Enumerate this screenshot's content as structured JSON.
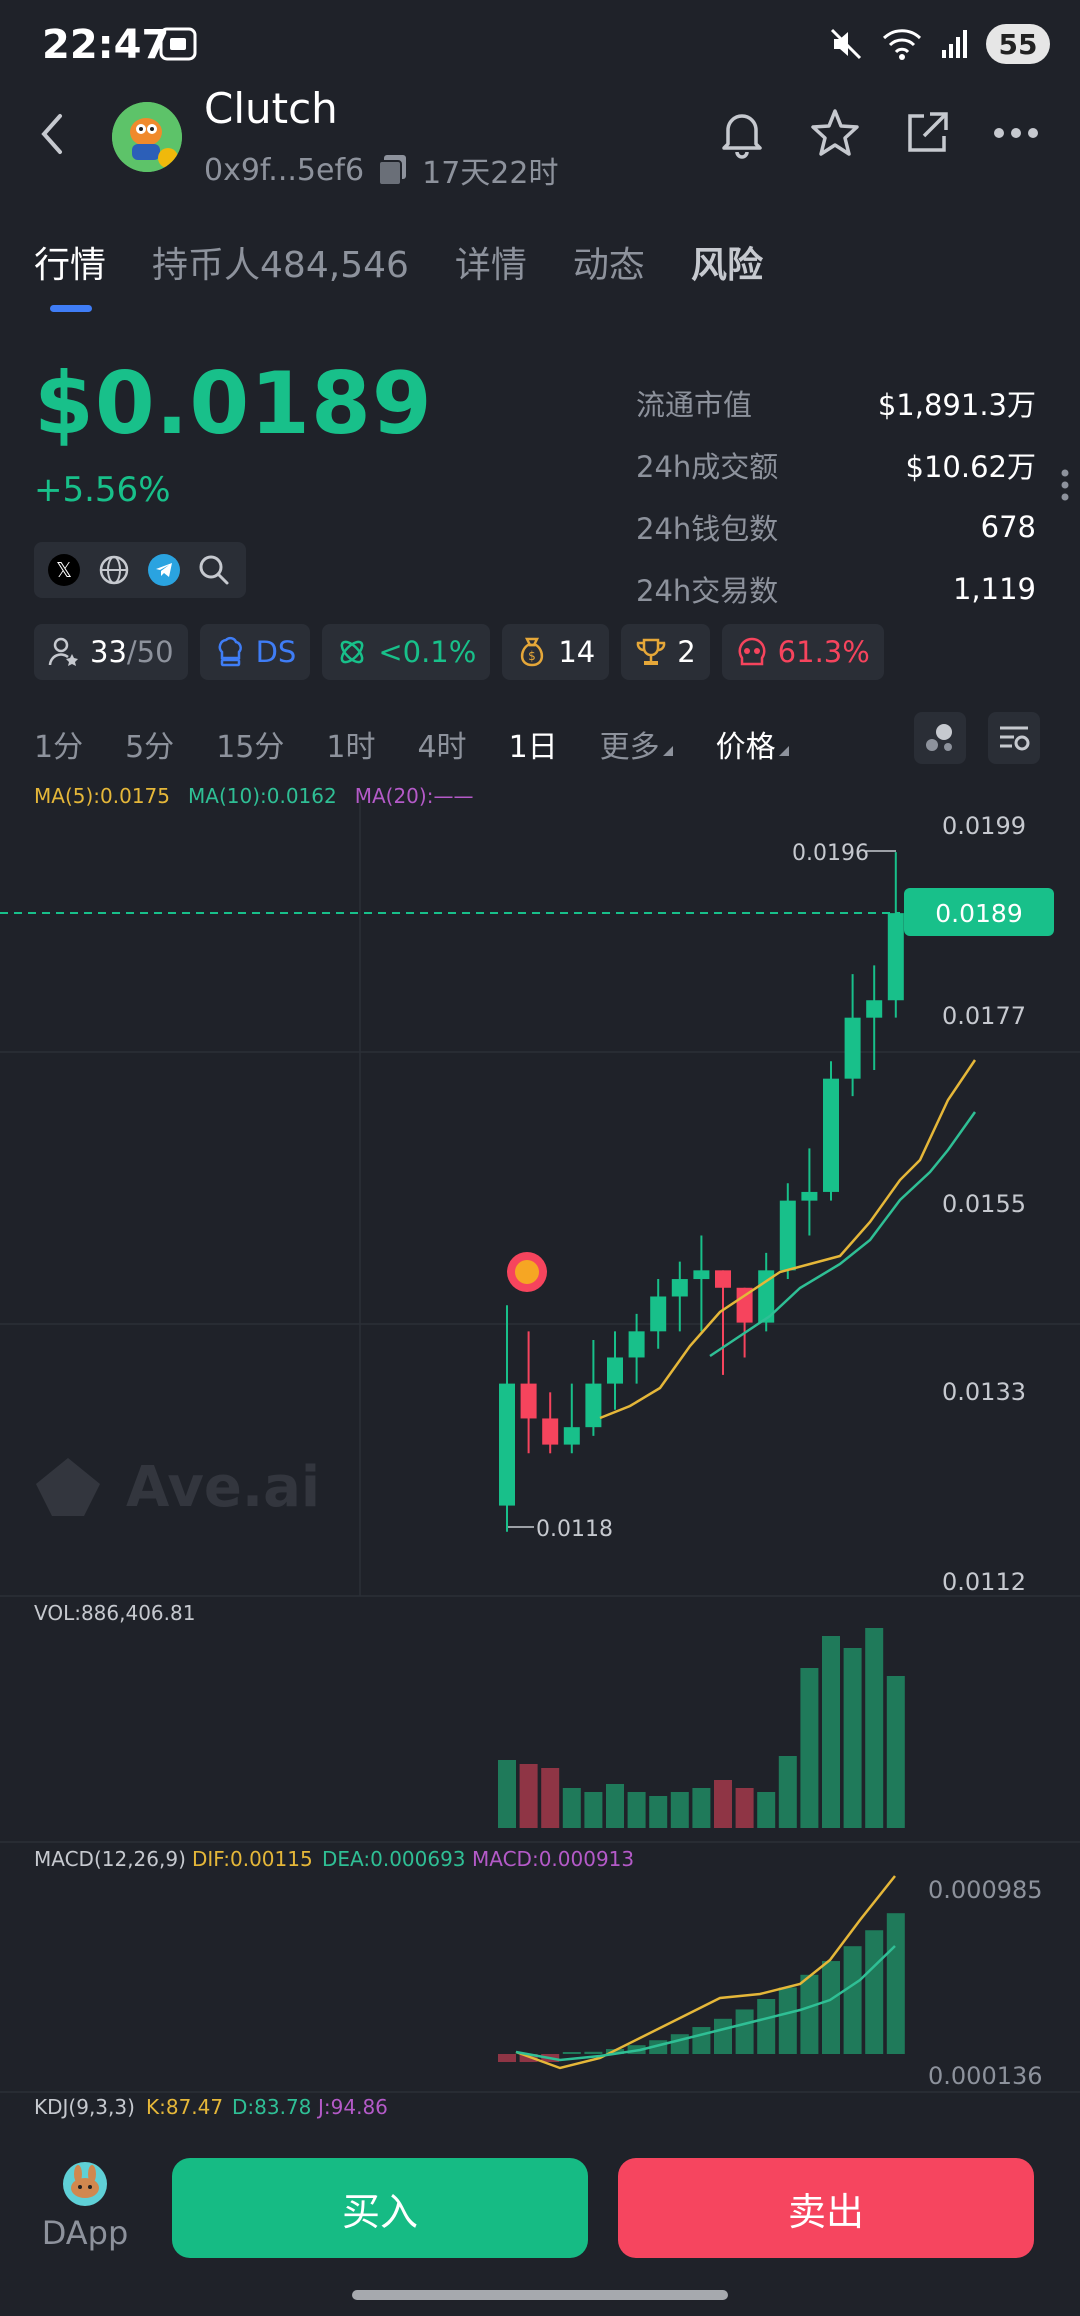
{
  "status_bar": {
    "time": "22:47",
    "battery": "55"
  },
  "header": {
    "name": "Clutch",
    "address": "0x9f...5ef6",
    "age": "17天22时"
  },
  "tabs": [
    {
      "label": "行情"
    },
    {
      "label": "持币人",
      "count": "484,546"
    },
    {
      "label": "详情"
    },
    {
      "label": "动态"
    },
    {
      "label": "风险"
    }
  ],
  "price": {
    "value": "$0.0189",
    "change": "+5.56%"
  },
  "stats": [
    {
      "label": "流通市值",
      "value": "$1,891.3万"
    },
    {
      "label": "24h成交额",
      "value": "$10.62万"
    },
    {
      "label": "24h钱包数",
      "value": "678"
    },
    {
      "label": "24h交易数",
      "value": "1,119"
    }
  ],
  "chips": {
    "holders_a": "33",
    "holders_b": "/50",
    "ds": "DS",
    "tax": "<0.1%",
    "money": "14",
    "trophy": "2",
    "risk": "61.3%"
  },
  "timeframes": [
    "1分",
    "5分",
    "15分",
    "1时",
    "4时",
    "1日",
    "更多",
    "价格"
  ],
  "ma_legend": {
    "ma5": "MA(5):0.0175",
    "ma10": "MA(10):0.0162",
    "ma20": "MA(20):——"
  },
  "watermark": "Ave.ai",
  "price_axis": [
    "0.0199",
    "0.0177",
    "0.0155",
    "0.0133",
    "0.0112"
  ],
  "current_price_tag": "0.0189",
  "high_label": "0.0196",
  "low_label": "0.0118",
  "vol_label": "VOL:886,406.81",
  "macd": {
    "title": "MACD(12,26,9)",
    "dif": "DIF:0.00115",
    "dea": "DEA:0.000693",
    "macd": "MACD:0.000913",
    "axis_top": "0.000985",
    "axis_bottom": "0.000136"
  },
  "kdj": {
    "title": "KDJ(9,3,3)",
    "k": "K:87.47",
    "d": "D:83.78",
    "j": "J:94.86"
  },
  "bottom": {
    "dapp": "DApp",
    "buy": "买入",
    "sell": "卖出"
  },
  "colors": {
    "up": "#18c08a",
    "down": "#f6445d",
    "accent": "#3f7df6",
    "ma5": "#e5b739",
    "ma10": "#2fbf95",
    "ma20": "#b45ac8"
  },
  "chart_data": {
    "type": "candlestick",
    "candles": [
      {
        "o": 0.0121,
        "h": 0.0144,
        "l": 0.0118,
        "c": 0.0135
      },
      {
        "o": 0.0135,
        "h": 0.0141,
        "l": 0.0127,
        "c": 0.0131
      },
      {
        "o": 0.0131,
        "h": 0.0134,
        "l": 0.0127,
        "c": 0.0128
      },
      {
        "o": 0.0128,
        "h": 0.0135,
        "l": 0.0127,
        "c": 0.013
      },
      {
        "o": 0.013,
        "h": 0.014,
        "l": 0.0129,
        "c": 0.0135
      },
      {
        "o": 0.0135,
        "h": 0.0141,
        "l": 0.0132,
        "c": 0.0138
      },
      {
        "o": 0.0138,
        "h": 0.0143,
        "l": 0.0135,
        "c": 0.0141
      },
      {
        "o": 0.0141,
        "h": 0.0147,
        "l": 0.0139,
        "c": 0.0145
      },
      {
        "o": 0.0145,
        "h": 0.0149,
        "l": 0.0141,
        "c": 0.0147
      },
      {
        "o": 0.0147,
        "h": 0.0152,
        "l": 0.0141,
        "c": 0.0148
      },
      {
        "o": 0.0148,
        "h": 0.0148,
        "l": 0.0136,
        "c": 0.0146
      },
      {
        "o": 0.0146,
        "h": 0.0146,
        "l": 0.0138,
        "c": 0.0142
      },
      {
        "o": 0.0142,
        "h": 0.015,
        "l": 0.0141,
        "c": 0.0148
      },
      {
        "o": 0.0148,
        "h": 0.0158,
        "l": 0.0147,
        "c": 0.0156
      },
      {
        "o": 0.0156,
        "h": 0.0162,
        "l": 0.0152,
        "c": 0.0157
      },
      {
        "o": 0.0157,
        "h": 0.0172,
        "l": 0.0156,
        "c": 0.017
      },
      {
        "o": 0.017,
        "h": 0.0182,
        "l": 0.0168,
        "c": 0.0177
      },
      {
        "o": 0.0177,
        "h": 0.0183,
        "l": 0.0171,
        "c": 0.0179
      },
      {
        "o": 0.0179,
        "h": 0.0196,
        "l": 0.0177,
        "c": 0.0189
      }
    ],
    "volume": [
      17,
      16,
      15,
      10,
      9,
      11,
      9,
      8,
      9,
      10,
      12,
      10,
      9,
      18,
      40,
      48,
      45,
      50,
      38
    ],
    "price_ylim": [
      0.0112,
      0.0199
    ]
  }
}
